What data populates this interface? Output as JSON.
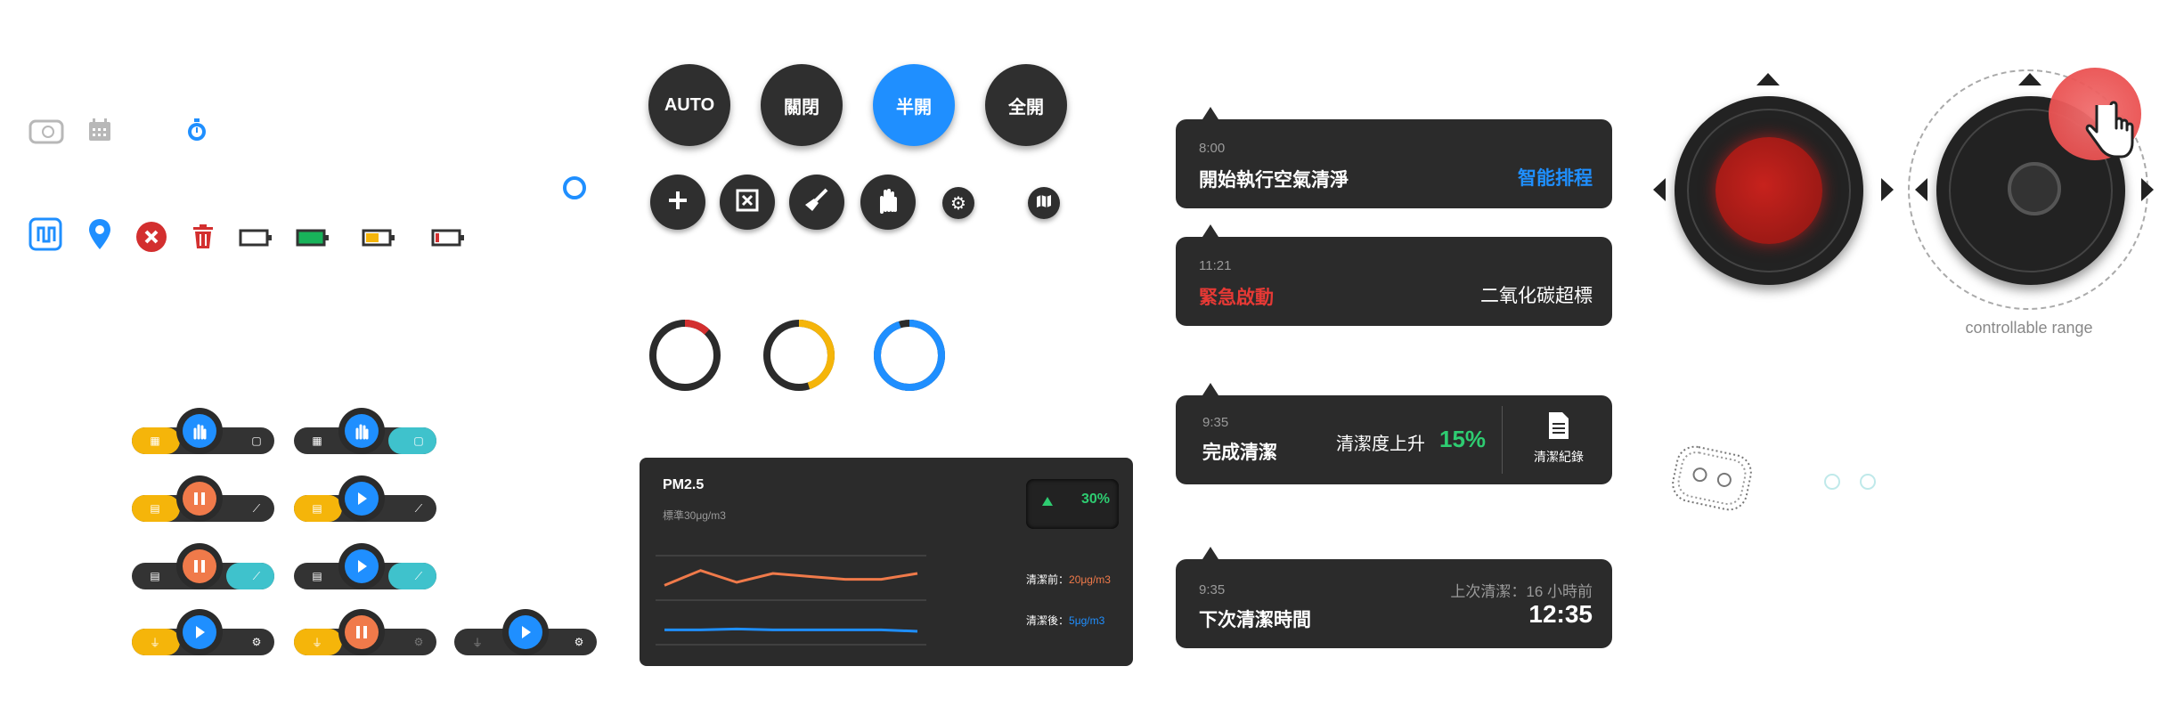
{
  "colors": {
    "accent_blue": "#1f8fff",
    "red": "#d32f2f",
    "orange": "#f07a4a",
    "yellow": "#f5b50a",
    "teal": "#3fc2cc",
    "green": "#2ecc71",
    "dark": "#2b2b2b"
  },
  "mode_buttons": [
    {
      "label": "AUTO"
    },
    {
      "label": "關閉"
    },
    {
      "label": "半開",
      "active": true
    },
    {
      "label": "全開"
    }
  ],
  "notifications": [
    {
      "time": "8:00",
      "main": "開始執行空氣清淨",
      "right": "智能排程"
    },
    {
      "time": "11:21",
      "main": "緊急啟動",
      "right": "二氧化碳超標"
    },
    {
      "time": "9:35",
      "main": "完成清潔",
      "middle": "清潔度上升",
      "percent": "15%",
      "record": "清潔紀錄"
    },
    {
      "time": "9:35",
      "main": "下次清潔時間",
      "top_right": "上次清潔：16 小時前",
      "right": "12:35"
    }
  ],
  "pm_panel": {
    "title": "PM2.5",
    "subtitle": "標準30μg/m3",
    "change": "30%",
    "legend_before_label": "清潔前：",
    "legend_before_value": "20μg/m3",
    "legend_after_label": "清潔後：",
    "legend_after_value": "5μg/m3"
  },
  "chart_data": {
    "type": "line",
    "x": [
      1,
      2,
      3,
      4,
      5,
      6,
      7,
      8
    ],
    "series": [
      {
        "values": [
          20,
          25,
          21,
          24,
          23,
          22,
          22,
          24
        ],
        "color": "#f07a4a"
      },
      {
        "values": [
          5,
          5,
          5.3,
          5,
          5,
          5,
          5,
          4.5
        ],
        "color": "#1f8fff"
      }
    ],
    "ylim": [
      0,
      30
    ]
  },
  "joystick": {
    "caption": "controllable range"
  },
  "rings": [
    {
      "progress": 0.12,
      "color": "#d32f2f"
    },
    {
      "progress": 0.45,
      "color": "#f5b50a"
    },
    {
      "progress": 0.95,
      "color": "#1f8fff"
    }
  ],
  "icons_row1": [
    "clock-device-icon",
    "calendar-icon",
    "stopwatch-icon"
  ],
  "icons_row2": [
    "app-logo-icon",
    "location-pin-icon",
    "close-circle-icon",
    "trash-icon",
    "battery-empty-icon",
    "battery-full-icon",
    "battery-low-icon",
    "battery-empty-icon"
  ],
  "action_icons": [
    "plus-icon",
    "close-square-icon",
    "broom-icon",
    "hand-icon",
    "gear-icon",
    "map-icon"
  ]
}
